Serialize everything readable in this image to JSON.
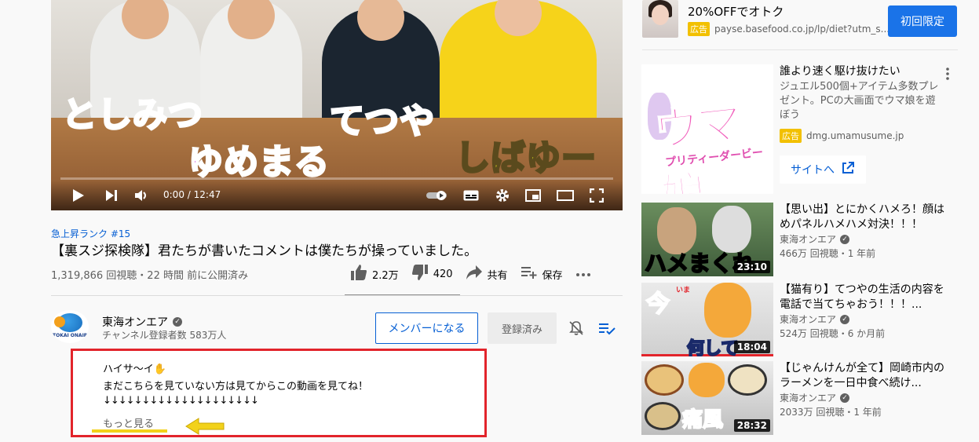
{
  "player": {
    "captions": [
      "としみつ",
      "ゆめまる",
      "てつや",
      "しばゆー"
    ],
    "time_current": "0:00",
    "time_separator": " / ",
    "time_total": "12:47"
  },
  "video": {
    "hashtag": "急上昇ランク #15",
    "title": "【裏スジ探検隊】君たちが書いたコメントは僕たちが操っていました。",
    "views": "1,319,866 回視聴・22 時間 前に公開済み",
    "likes": "2.2万",
    "dislikes": "420",
    "share_label": "共有",
    "save_label": "保存"
  },
  "channel": {
    "name": "東海オンエア",
    "logo_text": "TOKAI ONAIR",
    "subscribers": "チャンネル登録者数 583万人",
    "member_label": "メンバーになる",
    "subscribed_label": "登録済み"
  },
  "description": {
    "line1": "ハイサ〜イ✋",
    "line2": "まだこちらを見ていない方は見てからこの動画を見てね！",
    "line3": "↓↓↓↓↓↓↓↓↓↓↓↓↓↓↓↓↓↓↓↓",
    "more_label": "もっと見る"
  },
  "sidebar": {
    "ad_top": {
      "title": "20%OFFでオトク",
      "badge": "広告",
      "url": "payse.basefood.co.jp/lp/diet?utm_s...",
      "button": "初回限定"
    },
    "ad_uma": {
      "image_text": "ウマ娘",
      "image_subtext": "プリティーダービー",
      "title": "誰より速く駆け抜けたい",
      "desc": "ジュエル500個+アイテム多数プレゼント。PCの大画面でウマ娘を遊ぼう",
      "badge": "広告",
      "url": "dmg.umamusume.jp",
      "button": "サイトへ"
    },
    "recs": [
      {
        "title": "【思い出】とにかくハメろ！顔はめパネルハメハメ対決！！！",
        "channel": "東海オンエア",
        "meta": "466万 回視聴・1 年前",
        "duration": "23:10",
        "thumb_text": "ハメまくれ"
      },
      {
        "title": "【猫有り】てつやの生活の内容を電話で当てちゃおう！！！...",
        "channel": "東海オンエア",
        "meta": "524万 回視聴・6 か月前",
        "duration": "18:04",
        "thumb_text": "今",
        "thumb_ruby": "いま",
        "thumb_text2": "何して"
      },
      {
        "title": "【じゃんけんが全て】岡崎市内のラーメンを一日中食べ続け...",
        "channel": "東海オンエア",
        "meta": "2033万 回視聴・1 年前",
        "duration": "28:32",
        "thumb_text": "痛風"
      }
    ]
  },
  "colors": {
    "accent": "#065fd4",
    "highlight_box": "#e2242b",
    "underline": "#f2d21b",
    "ad_badge": "#f2c000"
  }
}
